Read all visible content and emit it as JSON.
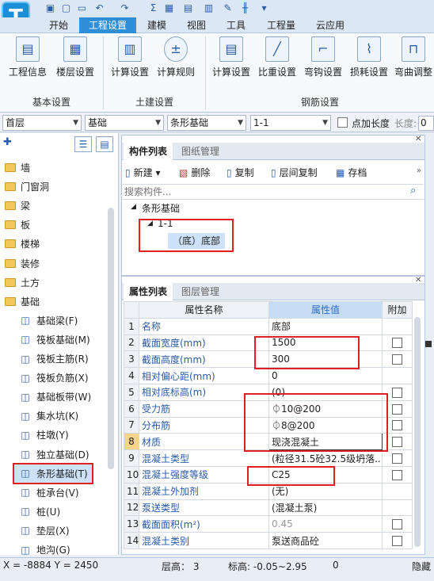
{
  "app": {
    "logo_letter": "T"
  },
  "ribbon_tabs": [
    "开始",
    "工程设置",
    "建模",
    "视图",
    "工具",
    "工程量",
    "云应用"
  ],
  "ribbon_groups": {
    "basic": {
      "label": "基本设置",
      "buttons": [
        "工程信息",
        "楼层设置"
      ]
    },
    "civil": {
      "label": "土建设置",
      "buttons": [
        "计算设置",
        "计算规则"
      ]
    },
    "rebar": {
      "label": "钢筋设置",
      "buttons": [
        "计算设置",
        "比重设置",
        "弯钩设置",
        "损耗设置",
        "弯曲调整"
      ]
    }
  },
  "selectors": {
    "floor": "首层",
    "category": "基础",
    "component_type": "条形基础",
    "component": "1-1",
    "point_length_label": "点加长度",
    "length_label": "长度:",
    "length_value": "0"
  },
  "tree": [
    {
      "label": "墙",
      "kind": "folder"
    },
    {
      "label": "门窗洞",
      "kind": "folder"
    },
    {
      "label": "梁",
      "kind": "folder"
    },
    {
      "label": "板",
      "kind": "folder"
    },
    {
      "label": "楼梯",
      "kind": "folder"
    },
    {
      "label": "装修",
      "kind": "folder"
    },
    {
      "label": "土方",
      "kind": "folder"
    },
    {
      "label": "基础",
      "kind": "folder-open"
    },
    {
      "label": "基础梁(F)",
      "kind": "item"
    },
    {
      "label": "筏板基础(M)",
      "kind": "item"
    },
    {
      "label": "筏板主筋(R)",
      "kind": "item"
    },
    {
      "label": "筏板负筋(X)",
      "kind": "item"
    },
    {
      "label": "基础板带(W)",
      "kind": "item"
    },
    {
      "label": "集水坑(K)",
      "kind": "item"
    },
    {
      "label": "柱墩(Y)",
      "kind": "item"
    },
    {
      "label": "独立基础(D)",
      "kind": "item"
    },
    {
      "label": "条形基础(T)",
      "kind": "item-selected"
    },
    {
      "label": "桩承台(V)",
      "kind": "item"
    },
    {
      "label": "桩(U)",
      "kind": "item"
    },
    {
      "label": "垫层(X)",
      "kind": "item"
    },
    {
      "label": "地沟(G)",
      "kind": "item"
    }
  ],
  "component_panel": {
    "tabs": [
      "构件列表",
      "图纸管理"
    ],
    "toolbar": [
      "新建",
      "删除",
      "复制",
      "层间复制",
      "存档"
    ],
    "search_placeholder": "搜索构件...",
    "tree_root": "条形基础",
    "tree_child": "1-1",
    "tree_leaf": "（底）底部"
  },
  "property_panel": {
    "tabs": [
      "属性列表",
      "图层管理"
    ],
    "headers": [
      "属性名称",
      "属性值",
      "附加"
    ],
    "rows": [
      {
        "n": "1",
        "name": "名称",
        "value": "底部",
        "cb": false
      },
      {
        "n": "2",
        "name": "截面宽度(mm)",
        "value": "1500",
        "cb": true
      },
      {
        "n": "3",
        "name": "截面高度(mm)",
        "value": "300",
        "cb": true
      },
      {
        "n": "4",
        "name": "相对偏心距(mm)",
        "value": "0",
        "cb": false
      },
      {
        "n": "5",
        "name": "相对底标高(m)",
        "value": "(0)",
        "cb": true
      },
      {
        "n": "6",
        "name": "受力筋",
        "value": "⏀10@200",
        "cb": true
      },
      {
        "n": "7",
        "name": "分布筋",
        "value": "⏀8@200",
        "cb": true
      },
      {
        "n": "8",
        "name": "材质",
        "value": "现浇混凝土",
        "cb": true
      },
      {
        "n": "9",
        "name": "混凝土类型",
        "value": "(粒径31.5砼32.5级坍落...",
        "cb": true
      },
      {
        "n": "10",
        "name": "混凝土强度等级",
        "value": "C25",
        "cb": true
      },
      {
        "n": "11",
        "name": "混凝土外加剂",
        "value": "(无)",
        "cb": false
      },
      {
        "n": "12",
        "name": "泵送类型",
        "value": "(混凝土泵)",
        "cb": false
      },
      {
        "n": "13",
        "name": "截面面积(m²)",
        "value": "0.45",
        "cb": true
      },
      {
        "n": "14",
        "name": "混凝土类别",
        "value": "泵送商品砼",
        "cb": true
      }
    ]
  },
  "status": {
    "coords": "X = -8884 Y = 2450",
    "floor_height": "层高： 3",
    "elevation": "标高: -0.05~2.95",
    "count": "0",
    "hide": "隐藏"
  }
}
